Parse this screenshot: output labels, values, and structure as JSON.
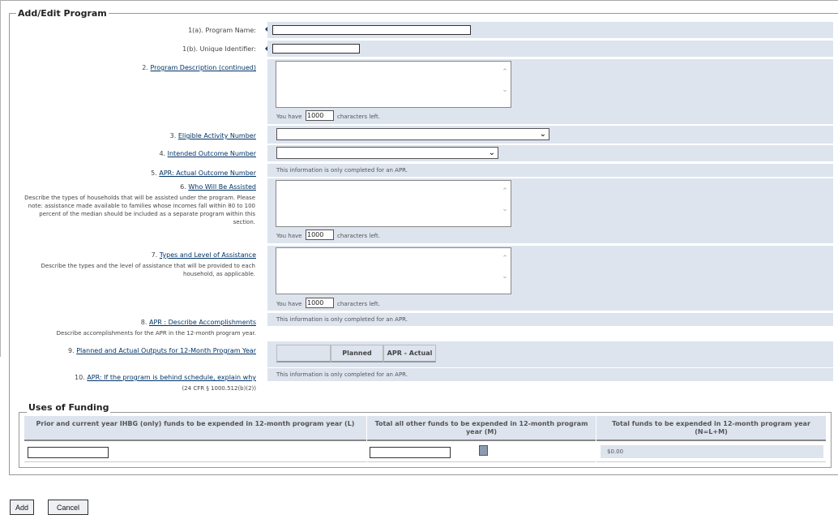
{
  "form": {
    "title": "Add/Edit Program",
    "program_name_label": "1(a). Program Name:",
    "program_name_value": "",
    "unique_id_label": "1(b). Unique Identifier:",
    "unique_id_value": "",
    "desc_prefix": "2.",
    "desc_link": "Program Description (continued)",
    "chars_pre": "You have",
    "chars_post": "characters left.",
    "chars_left_1": "1000",
    "eligible_prefix": "3.",
    "eligible_link": "Eligible Activity Number",
    "eligible_selected": "",
    "intended_prefix": "4.",
    "intended_link": "Intended Outcome Number",
    "intended_selected": "",
    "apr_outcome_prefix": "5.",
    "apr_outcome_link": "APR: Actual Outcome Number",
    "apr_only_note": "This information is only completed for an APR.",
    "who_prefix": "6.",
    "who_link": "Who Will Be Assisted",
    "who_desc": "Describe the types of households that will be assisted under the program. Please note: assistance made available to families whose incomes fall within 80 to 100 percent of the median should be included as a separate program within this section.",
    "chars_left_2": "1000",
    "types_prefix": "7.",
    "types_link": "Types and Level of Assistance",
    "types_desc": "Describe the types and the level of assistance that will be provided to each household, as applicable.",
    "chars_left_3": "1000",
    "accomp_prefix": "8.",
    "accomp_link": "APR : Describe Accomplishments",
    "accomp_desc": "Describe accomplishments for the APR in the 12-month program year.",
    "outputs_prefix": "9.",
    "outputs_link": "Planned and Actual Outputs for 12-Month Program Year",
    "outputs_col_planned": "Planned",
    "outputs_col_apr": "APR - Actual",
    "behind_prefix": "10.",
    "behind_link": "APR: If the program is behind schedule, explain why",
    "behind_cfr": "(24 CFR § 1000.512(b)(2))"
  },
  "funding": {
    "title": "Uses of Funding",
    "col_l": "Prior and current year IHBG (only) funds to be expended in 12-month program year (L)",
    "col_m": "Total all other funds to be expended in 12-month program year (M)",
    "col_n": "Total funds to be expended in 12-month program year (N=L+M)",
    "value_l": "",
    "value_m": "",
    "total": "$0.00"
  },
  "buttons": {
    "add": "Add",
    "cancel": "Cancel"
  },
  "icons": {
    "calculator": "calculator-icon",
    "required_marker": "required-marker-icon",
    "scroll_up": "scroll-up-icon",
    "scroll_down": "scroll-down-icon",
    "dropdown": "chevron-down-icon"
  },
  "colors": {
    "value_cell_bg": "#dde4ee",
    "link": "#003366",
    "border": "#999999"
  }
}
